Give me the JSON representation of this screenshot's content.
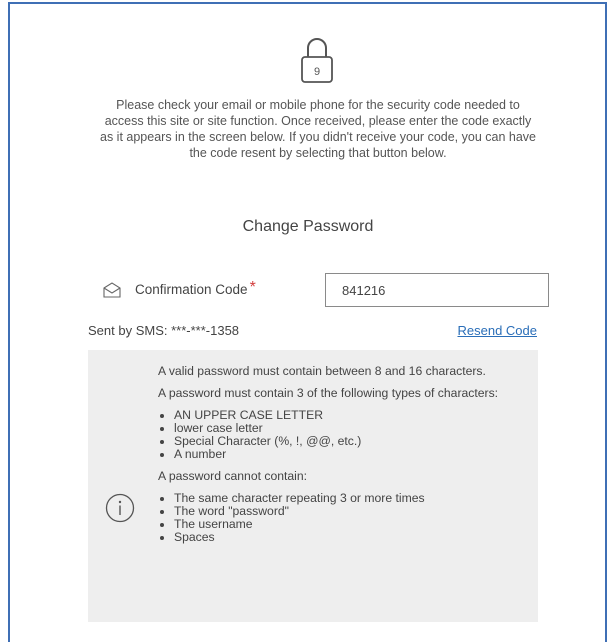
{
  "intro_text": "Please check your email or mobile phone for the security code needed to access this site or site function. Once received, please enter the code exactly as it appears in the screen below. If you didn't receive your code, you can have the code resent by selecting that button below.",
  "section_title": "Change Password",
  "confirmation": {
    "label": "Confirmation Code",
    "required_marker": "*",
    "value": "841216"
  },
  "sent_by": "Sent by SMS: ***-***-1358",
  "resend_label": "Resend Code",
  "rules": {
    "length_rule": "A valid password must contain between 8 and 16 characters.",
    "types_heading": "A password must contain 3 of the following types of characters:",
    "types": [
      "AN UPPER CASE LETTER",
      "lower case letter",
      "Special Character (%, !, @@, etc.)",
      "A number"
    ],
    "cannot_heading": "A password cannot contain:",
    "cannot": [
      "The same character repeating 3 or more times",
      "The word \"password\"",
      "The username",
      "Spaces"
    ]
  },
  "icons": {
    "lock": "lock-icon",
    "mail": "mail-icon",
    "info": "info-icon"
  },
  "colors": {
    "frame_border": "#3f6fb5",
    "link": "#2a6eb8",
    "required": "#d23b3b",
    "rules_bg": "#eeeeee"
  }
}
